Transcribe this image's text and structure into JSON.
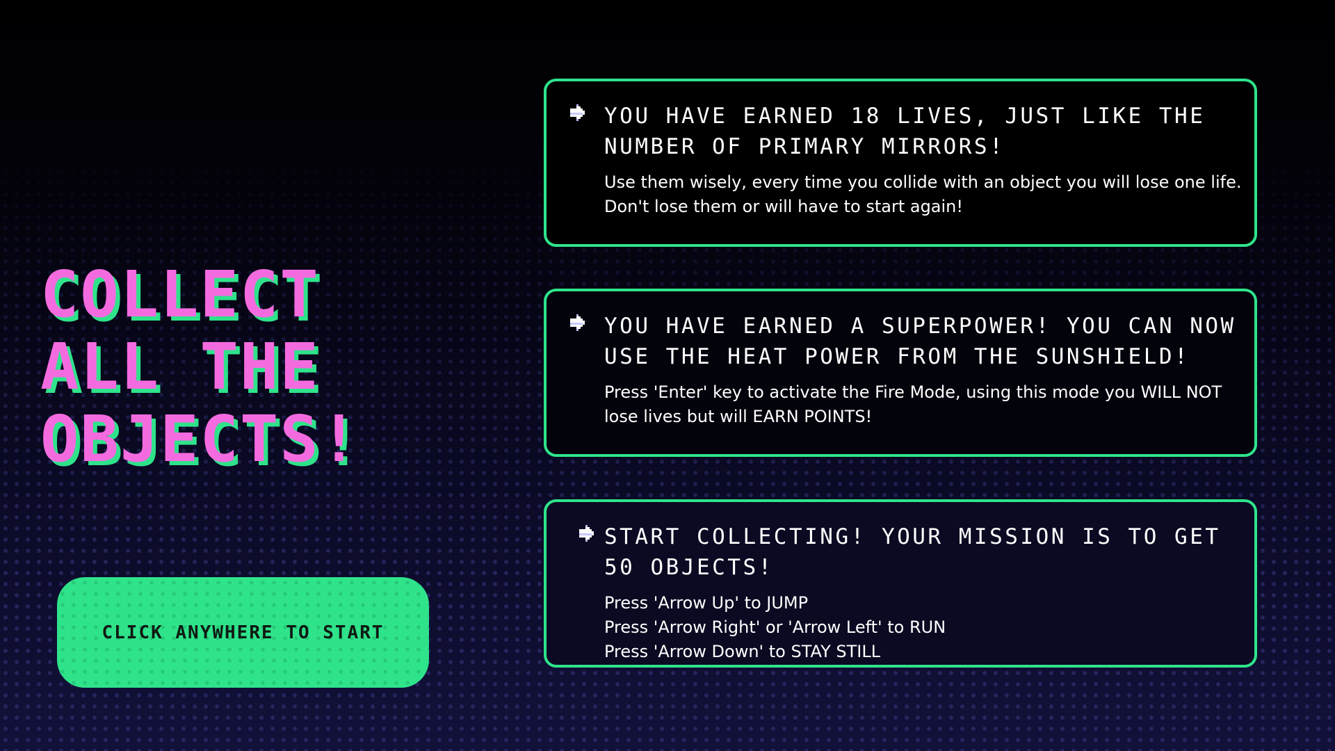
{
  "headline": {
    "lines": [
      "COLLECT",
      "ALL THE",
      "OBJECTS!"
    ]
  },
  "start_button": {
    "label": "CLICK ANYWHERE TO START"
  },
  "cards": [
    {
      "icon": "pixel-arrow-icon",
      "title": "YOU HAVE EARNED 18 LIVES, JUST LIKE THE NUMBER OF PRIMARY MIRRORS!",
      "body": [
        "Use them wisely, every time you collide with an object you will lose one life. Don't lose them or will have to start again!"
      ]
    },
    {
      "icon": "pixel-arrow-icon",
      "title": "YOU HAVE EARNED A SUPERPOWER! YOU CAN NOW USE THE HEAT POWER FROM THE  SUNSHIELD!",
      "body": [
        "Press 'Enter' key to activate the Fire Mode, using this mode you WILL NOT lose lives but will EARN POINTS!"
      ]
    },
    {
      "icon": "pixel-arrow-icon",
      "title": "START COLLECTING! YOUR MISSION IS TO GET 50 OBJECTS!",
      "body": [
        "Press 'Arrow Up' to JUMP",
        "Press 'Arrow Right' or 'Arrow Left' to RUN",
        "Press 'Arrow Down' to STAY STILL"
      ]
    }
  ],
  "colors": {
    "headline_fill": "#f46be0",
    "headline_shadow": "#2fe38b",
    "accent_green": "#2fe38b",
    "background": "#000000",
    "background_bottom": "#12113a",
    "text": "#ffffff"
  }
}
